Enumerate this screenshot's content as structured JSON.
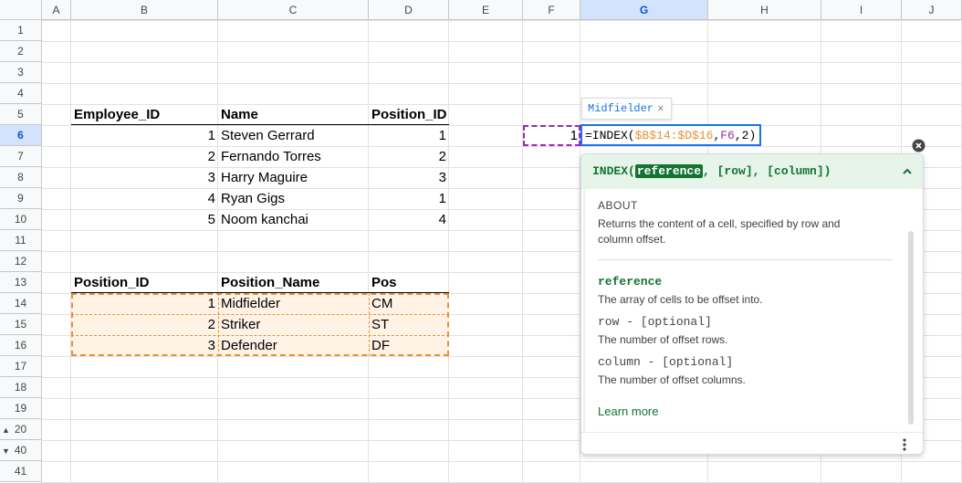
{
  "columns": [
    "A",
    "B",
    "C",
    "D",
    "E",
    "F",
    "G",
    "H",
    "I",
    "J"
  ],
  "rows": [
    "1",
    "2",
    "3",
    "4",
    "5",
    "6",
    "7",
    "8",
    "9",
    "10",
    "11",
    "12",
    "13",
    "14",
    "15",
    "16",
    "17",
    "18",
    "19",
    "20",
    "40",
    "41"
  ],
  "cells": {
    "b5": "Employee_ID",
    "c5": "Name",
    "d5": "Position_ID",
    "b6": "1",
    "c6": "Steven Gerrard",
    "d6": "1",
    "b7": "2",
    "c7": "Fernando Torres",
    "d7": "2",
    "b8": "3",
    "c8": "Harry Maguire",
    "d8": "3",
    "b9": "4",
    "c9": "Ryan Gigs",
    "d9": "1",
    "b10": "5",
    "c10": "Noom kanchai",
    "d10": "4",
    "b13": "Position_ID",
    "c13": "Position_Name",
    "d13": "Pos",
    "b14": "1",
    "c14": "Midfielder",
    "d14": "CM",
    "b15": "2",
    "c15": "Striker",
    "d15": "ST",
    "b16": "3",
    "c16": "Defender",
    "d16": "DF",
    "f6": "1"
  },
  "formula": {
    "prefix": "=INDEX(",
    "range": "$B$14:$D$16",
    "comma1": ",",
    "arg2": "F6",
    "comma2": ",",
    "arg3": "2",
    "suffix": ")"
  },
  "preview": {
    "value": "Midfielder",
    "close": "×"
  },
  "help": {
    "fn": "INDEX(",
    "param": "reference",
    "rest": ", [row], [column])",
    "about_title": "ABOUT",
    "about_text": "Returns the content of a cell, specified by row and column offset.",
    "p1_name": "reference",
    "p1_desc": "The array of cells to be offset into.",
    "p2_name": "row - [optional]",
    "p2_desc": "The number of offset rows.",
    "p3_name": "column - [optional]",
    "p3_desc": "The number of offset columns.",
    "learn_more": "Learn more"
  },
  "colors": {
    "accent": "#0b57d0",
    "orange": "#e69138",
    "purple": "#9c27b0",
    "green_header": "#e6f4ea",
    "green_text": "#137333"
  }
}
